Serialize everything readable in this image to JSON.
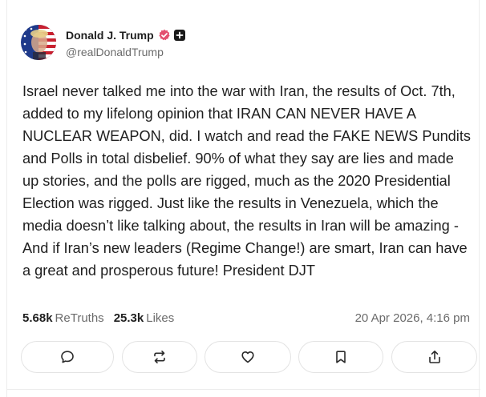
{
  "post": {
    "author": {
      "display_name": "Donald J. Trump",
      "handle": "@realDonaldTrump",
      "verified": true
    },
    "text": "Israel never talked me into the war with Iran, the results of Oct. 7th, added to my lifelong opinion that IRAN CAN NEVER HAVE A NUCLEAR WEAPON, did. I watch and read the FAKE NEWS Pundits and Polls in total disbelief. 90% of what they say are lies and made up stories, and the polls are rigged, much as the 2020 Presidential Election was rigged. Just like the results in Venezuela, which the media doesn’t like talking about, the results in Iran will be amazing - And if Iran’s new leaders (Regime Change!) are smart, Iran can have a great and prosperous future! President DJT",
    "stats": {
      "retruths_count": "5.68k",
      "retruths_label": "ReTruths",
      "likes_count": "25.3k",
      "likes_label": "Likes"
    },
    "timestamp": "20 Apr 2026, 4:16 pm"
  },
  "actions": [
    {
      "name": "reply",
      "icon": "comment-icon"
    },
    {
      "name": "retruth",
      "icon": "repost-icon"
    },
    {
      "name": "like",
      "icon": "heart-icon"
    },
    {
      "name": "bookmark",
      "icon": "bookmark-icon"
    },
    {
      "name": "share",
      "icon": "share-icon"
    }
  ],
  "colors": {
    "verified_badge": "#e3506f",
    "muted_text": "#6b6b6b",
    "border": "#e3e3e3"
  }
}
